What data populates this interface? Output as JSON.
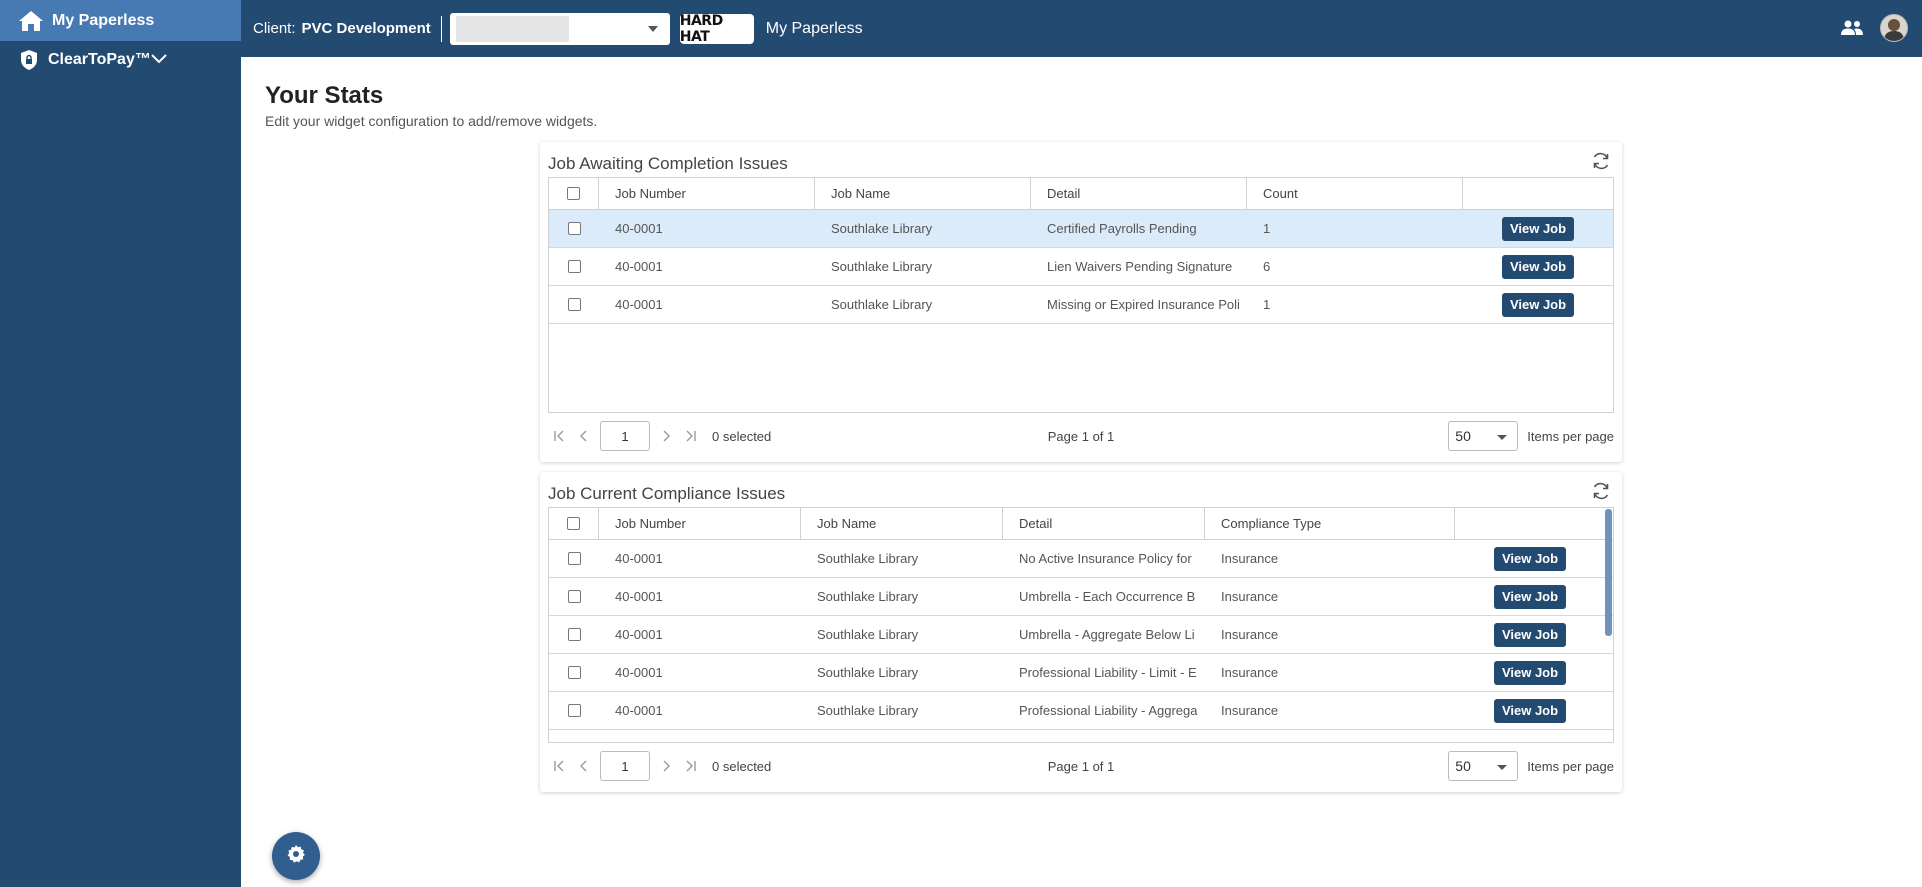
{
  "sidebar": {
    "items": [
      {
        "label": "My Paperless",
        "icon": "home-icon",
        "active": true
      },
      {
        "label": "ClearToPay™",
        "icon": "shield-lock-icon",
        "expandable": true
      }
    ]
  },
  "header": {
    "client_label": "Client:",
    "client_name": "PVC Development",
    "logo_text": "HARD HAT",
    "app_name": "My Paperless",
    "right_icons": [
      "people-icon",
      "avatar"
    ]
  },
  "main": {
    "title": "Your Stats",
    "subtitle": "Edit your widget configuration to add/remove widgets."
  },
  "widget1": {
    "title": "Job Awaiting Completion Issues",
    "columns": [
      "Job Number",
      "Job Name",
      "Detail",
      "Count"
    ],
    "rows": [
      {
        "job_number": "40-0001",
        "job_name": "Southlake Library",
        "detail": "Certified Payrolls Pending",
        "count": "1",
        "action": "View Job"
      },
      {
        "job_number": "40-0001",
        "job_name": "Southlake Library",
        "detail": "Lien Waivers Pending Signature",
        "count": "6",
        "action": "View Job"
      },
      {
        "job_number": "40-0001",
        "job_name": "Southlake Library",
        "detail": "Missing or Expired Insurance Poli",
        "count": "1",
        "action": "View Job"
      }
    ],
    "pager": {
      "page_input": "1",
      "selected": "0 selected",
      "page_info": "Page 1 of 1",
      "page_size": "50",
      "items_per_page": "Items per page"
    }
  },
  "widget2": {
    "title": "Job Current Compliance Issues",
    "columns": [
      "Job Number",
      "Job Name",
      "Detail",
      "Compliance Type"
    ],
    "rows": [
      {
        "job_number": "40-0001",
        "job_name": "Southlake Library",
        "detail": "No Active Insurance Policy for",
        "type": "Insurance",
        "action": "View Job"
      },
      {
        "job_number": "40-0001",
        "job_name": "Southlake Library",
        "detail": "Umbrella - Each Occurrence B",
        "type": "Insurance",
        "action": "View Job"
      },
      {
        "job_number": "40-0001",
        "job_name": "Southlake Library",
        "detail": "Umbrella - Aggregate Below Li",
        "type": "Insurance",
        "action": "View Job"
      },
      {
        "job_number": "40-0001",
        "job_name": "Southlake Library",
        "detail": "Professional Liability - Limit - E",
        "type": "Insurance",
        "action": "View Job"
      },
      {
        "job_number": "40-0001",
        "job_name": "Southlake Library",
        "detail": "Professional Liability - Aggrega",
        "type": "Insurance",
        "action": "View Job"
      }
    ],
    "pager": {
      "page_input": "1",
      "selected": "0 selected",
      "page_info": "Page 1 of 1",
      "page_size": "50",
      "items_per_page": "Items per page"
    }
  },
  "colors": {
    "navy": "#234a70",
    "sidebar_active": "#4779b3",
    "row_selected": "#dcebfa"
  }
}
